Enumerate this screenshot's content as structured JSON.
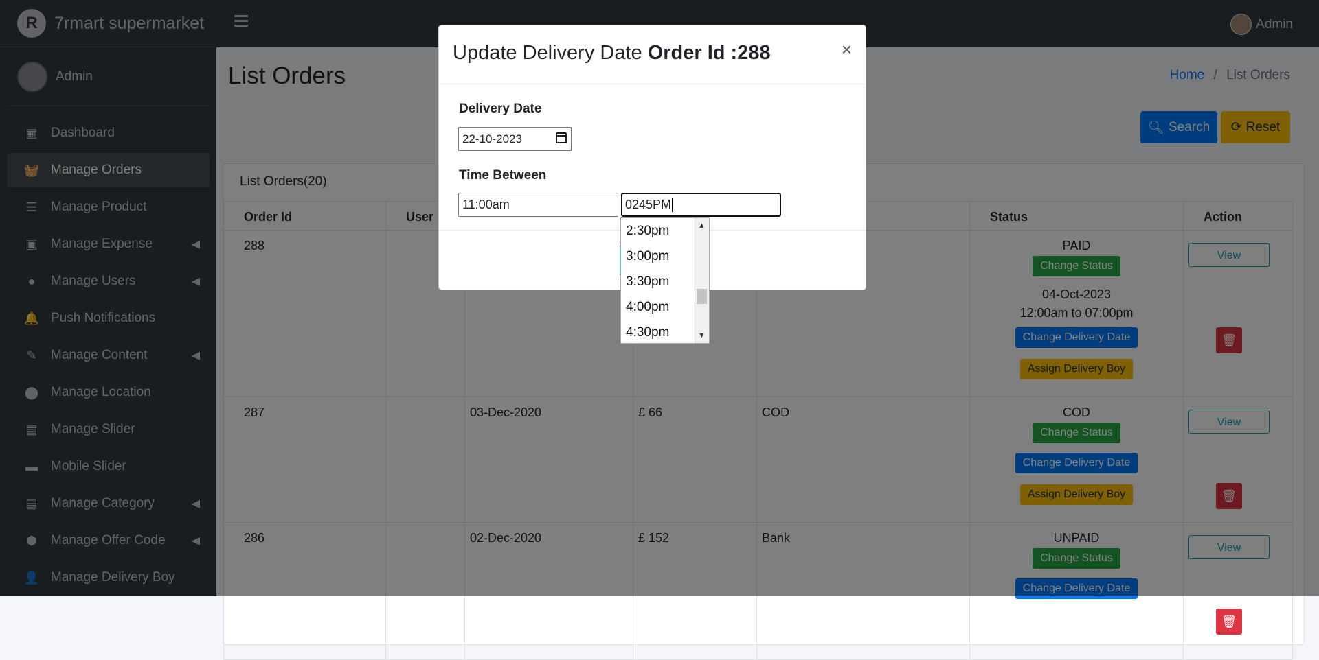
{
  "app": {
    "brand": "7rmart supermarket",
    "logo_letter": "R"
  },
  "topbar": {
    "user": "Admin"
  },
  "sidebar": {
    "user": "Admin",
    "items": [
      {
        "label": "Dashboard",
        "icon": "dashboard-icon",
        "glyph": "▦",
        "caret": false,
        "active": false
      },
      {
        "label": "Manage Orders",
        "icon": "basket-icon",
        "glyph": "🧺",
        "caret": false,
        "active": true
      },
      {
        "label": "Manage Product",
        "icon": "list-icon",
        "glyph": "☰",
        "caret": false,
        "active": false
      },
      {
        "label": "Manage Expense",
        "icon": "money-icon",
        "glyph": "▣",
        "caret": true,
        "active": false
      },
      {
        "label": "Manage Users",
        "icon": "user-icon",
        "glyph": "●",
        "caret": true,
        "active": false
      },
      {
        "label": "Push Notifications",
        "icon": "bell-icon",
        "glyph": "🔔",
        "caret": false,
        "active": false
      },
      {
        "label": "Manage Content",
        "icon": "edit-icon",
        "glyph": "✎",
        "caret": true,
        "active": false
      },
      {
        "label": "Manage Location",
        "icon": "map-marker-icon",
        "glyph": "⬤",
        "caret": false,
        "active": false
      },
      {
        "label": "Manage Slider",
        "icon": "slides-icon",
        "glyph": "▤",
        "caret": false,
        "active": false
      },
      {
        "label": "Mobile Slider",
        "icon": "minus-icon",
        "glyph": "▬",
        "caret": false,
        "active": false
      },
      {
        "label": "Manage Category",
        "icon": "list-alt-icon",
        "glyph": "▤",
        "caret": true,
        "active": false
      },
      {
        "label": "Manage Offer Code",
        "icon": "cubes-icon",
        "glyph": "⬢",
        "caret": true,
        "active": false
      },
      {
        "label": "Manage Delivery Boy",
        "icon": "user-plus-icon",
        "glyph": "👤",
        "caret": false,
        "active": false
      }
    ]
  },
  "page": {
    "title": "List Orders",
    "breadcrumb_home": "Home",
    "breadcrumb_sep": "/",
    "breadcrumb_current": "List Orders",
    "search_label": "Search",
    "reset_label": "Reset",
    "card_title": "List Orders(20)"
  },
  "table": {
    "headers": [
      "Order Id",
      "User",
      "",
      "",
      "",
      "Status",
      "Action"
    ],
    "rows": [
      {
        "id": "288",
        "user": "",
        "date": "",
        "amount": "",
        "payment": "",
        "status": "PAID",
        "delivery_date": "04-Oct-2023",
        "delivery_time": "12:00am to 07:00pm",
        "assign": true
      },
      {
        "id": "287",
        "user": "",
        "date": "03-Dec-2020",
        "amount": "£ 66",
        "payment": "COD",
        "status": "COD",
        "delivery_date": "",
        "delivery_time": "",
        "assign": true
      },
      {
        "id": "286",
        "user": "",
        "date": "02-Dec-2020",
        "amount": "£ 152",
        "payment": "Bank",
        "status": "UNPAID",
        "delivery_date": "",
        "delivery_time": "",
        "assign": false
      }
    ],
    "change_status": "Change Status",
    "change_delivery": "Change Delivery Date",
    "assign_boy": "Assign Delivery Boy",
    "view": "View"
  },
  "modal": {
    "title_prefix": "Update Delivery Date ",
    "title_bold": "Order Id :288",
    "close": "×",
    "delivery_label": "Delivery Date",
    "delivery_value": "22-10-2023",
    "time_label": "Time Between",
    "time_from": "11:00am",
    "time_to": "0245PM"
  },
  "dropdown": {
    "options": [
      "2:30pm",
      "3:00pm",
      "3:30pm",
      "4:00pm",
      "4:30pm"
    ]
  },
  "colors": {
    "primary": "#007bff",
    "warning": "#ffc107",
    "success": "#28a745",
    "danger": "#dc3545",
    "info": "#17a2b8",
    "dark": "#343a40"
  }
}
